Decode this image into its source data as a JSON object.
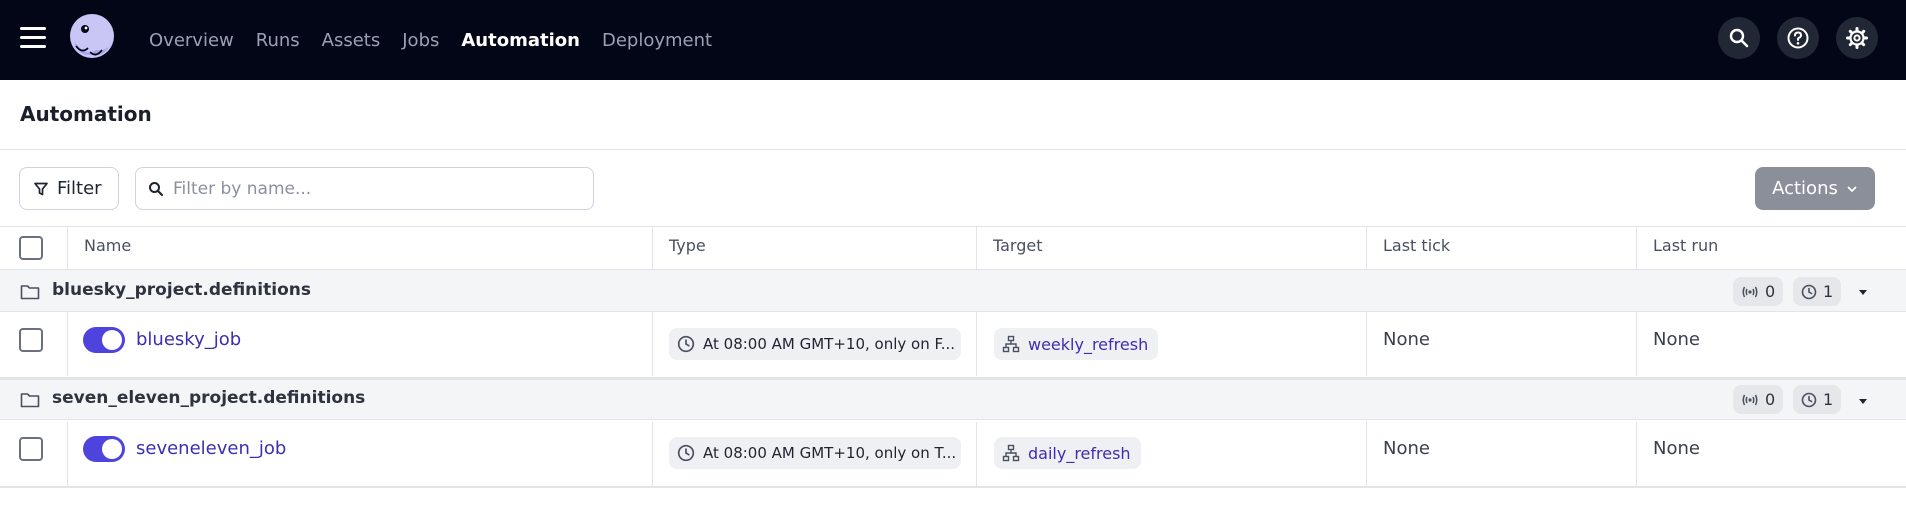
{
  "nav": {
    "items": [
      {
        "label": "Overview",
        "active": false
      },
      {
        "label": "Runs",
        "active": false
      },
      {
        "label": "Assets",
        "active": false
      },
      {
        "label": "Jobs",
        "active": false
      },
      {
        "label": "Automation",
        "active": true
      },
      {
        "label": "Deployment",
        "active": false
      }
    ],
    "icons": [
      "search-icon",
      "help-icon",
      "gear-icon"
    ]
  },
  "page": {
    "title": "Automation"
  },
  "toolbar": {
    "filter_label": "Filter",
    "search_placeholder": "Filter by name...",
    "search_value": "",
    "actions_label": "Actions"
  },
  "table": {
    "headers": [
      "Name",
      "Type",
      "Target",
      "Last tick",
      "Last run"
    ],
    "groups": [
      {
        "name": "bluesky_project.definitions",
        "sensor_count": "0",
        "schedule_count": "1",
        "rows": [
          {
            "name": "bluesky_job",
            "enabled": true,
            "type": "At 08:00 AM GMT+10, only on F...",
            "target": "weekly_refresh",
            "last_tick": "None",
            "last_run": "None"
          }
        ]
      },
      {
        "name": "seven_eleven_project.definitions",
        "sensor_count": "0",
        "schedule_count": "1",
        "rows": [
          {
            "name": "seveneleven_job",
            "enabled": true,
            "type": "At 08:00 AM GMT+10, only on T...",
            "target": "daily_refresh",
            "last_tick": "None",
            "last_run": "None"
          }
        ]
      }
    ]
  },
  "colors": {
    "topbar_bg": "#030616",
    "accent": "#4f43dd",
    "link": "#3b2fb0",
    "actions_bg": "#8b8f99"
  }
}
